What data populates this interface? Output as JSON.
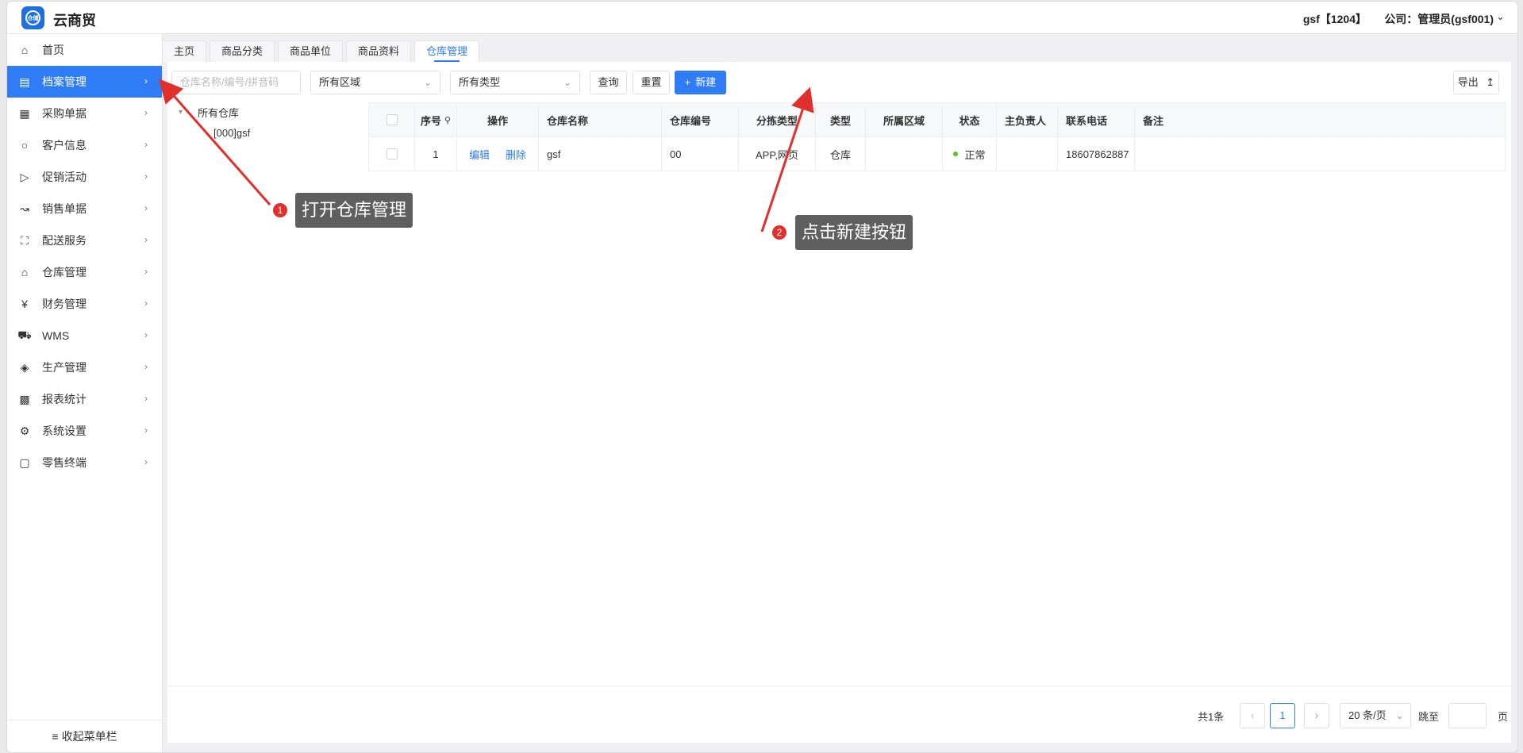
{
  "app": {
    "title": "云商贸",
    "logo_text": "仓储",
    "user": "gsf【1204】",
    "company": "公司：管理员(gsf001)"
  },
  "sidebar": {
    "items": [
      {
        "label": "首页",
        "icon": "home-icon",
        "has_children": false
      },
      {
        "label": "档案管理",
        "icon": "archive-icon",
        "has_children": true,
        "active": true
      },
      {
        "label": "采购单据",
        "icon": "purchase-doc-icon",
        "has_children": true
      },
      {
        "label": "客户信息",
        "icon": "user-icon",
        "has_children": true
      },
      {
        "label": "促销活动",
        "icon": "megaphone-icon",
        "has_children": true
      },
      {
        "label": "销售单据",
        "icon": "line-chart-icon",
        "has_children": true
      },
      {
        "label": "配送服务",
        "icon": "cart-icon",
        "has_children": true
      },
      {
        "label": "仓库管理",
        "icon": "warehouse-icon",
        "has_children": true
      },
      {
        "label": "财务管理",
        "icon": "yen-icon",
        "has_children": true
      },
      {
        "label": "WMS",
        "icon": "car-icon",
        "has_children": true
      },
      {
        "label": "生产管理",
        "icon": "network-icon",
        "has_children": true
      },
      {
        "label": "报表统计",
        "icon": "bar-chart-icon",
        "has_children": true
      },
      {
        "label": "系统设置",
        "icon": "gear-icon",
        "has_children": true
      },
      {
        "label": "零售终端",
        "icon": "bag-icon",
        "has_children": true
      }
    ],
    "collapse_label": "收起菜单栏"
  },
  "tabs": [
    {
      "label": "主页"
    },
    {
      "label": "商品分类"
    },
    {
      "label": "商品单位"
    },
    {
      "label": "商品资料"
    },
    {
      "label": "仓库管理",
      "active": true
    }
  ],
  "filters": {
    "search_placeholder": "仓库名称/编号/拼音码",
    "region_value": "所有区域",
    "type_value": "所有类型",
    "query_label": "查询",
    "reset_label": "重置",
    "new_label": "新建",
    "export_label": "导出"
  },
  "tree": {
    "root": "所有仓库",
    "children": [
      "[000]gsf"
    ]
  },
  "table": {
    "headers": [
      "序号",
      "操作",
      "仓库名称",
      "仓库编号",
      "分拣类型",
      "类型",
      "所属区域",
      "状态",
      "主负责人",
      "联系电话",
      "备注"
    ],
    "rows": [
      {
        "index": "1",
        "edit": "编辑",
        "delete": "删除",
        "name": "gsf",
        "code": "00",
        "sort_type": "APP,网页",
        "type": "仓库",
        "region": "",
        "status": "正常",
        "owner": "",
        "phone": "18607862887",
        "remark": ""
      }
    ]
  },
  "pagination": {
    "total": "共1条",
    "current_page": "1",
    "page_size": "20 条/页",
    "jump_label": "跳至",
    "page_unit": "页"
  },
  "annotations": [
    {
      "number": "1",
      "text": "打开仓库管理"
    },
    {
      "number": "2",
      "text": "点击新建按钮"
    }
  ],
  "colors": {
    "accent": "#2f7cf6",
    "annotation_red": "#e0302c",
    "status_green": "#52c41a",
    "callout_bg": "#5f5f5f"
  }
}
